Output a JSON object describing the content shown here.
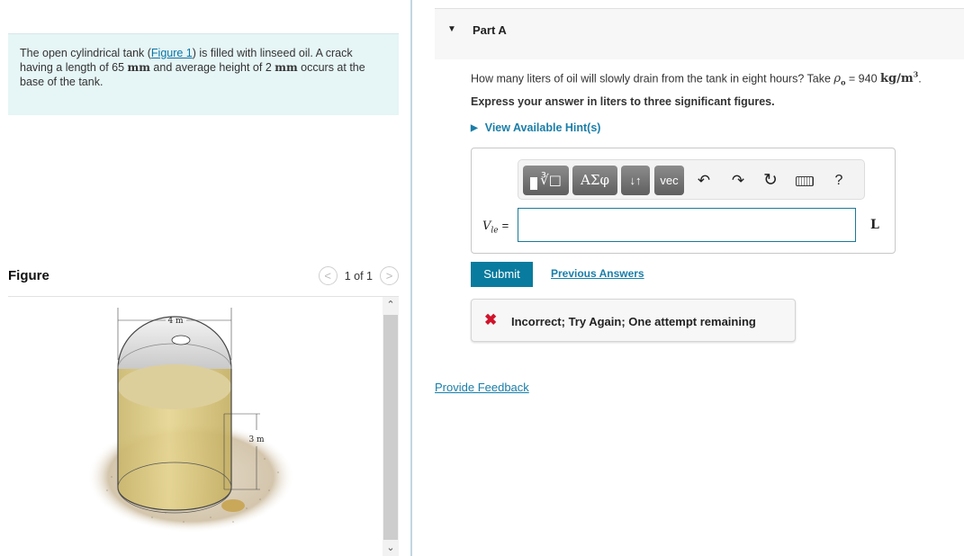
{
  "problem": {
    "text_before_link": "The open cylindrical tank (",
    "figure_link": "Figure 1",
    "text_after_link": ") is filled with linseed oil. A crack having a length of 65 ",
    "unit_mm_1": "mm",
    "text_mid": " and average height of 2 ",
    "unit_mm_2": "mm",
    "text_end": " occurs at the base of the tank."
  },
  "figure": {
    "title": "Figure",
    "counter": "1 of 1",
    "prev_icon": "chevron-left-icon",
    "next_icon": "chevron-right-icon",
    "diameter_label": "4 m",
    "height_label": "3 m",
    "colors": {
      "oil": "#d9c37a",
      "ground": "#d9cdb8",
      "tank_rim": "#cfcfcf"
    }
  },
  "part": {
    "caret": "▼",
    "title": "Part A",
    "question_prefix": "How many liters of oil will slowly drain from the tank in eight hours? Take ",
    "rho_symbol": "ρ",
    "rho_sub": "o",
    "question_equals": " = 940 ",
    "density_unit": "kg/m",
    "density_exp": "3",
    "question_suffix": ".",
    "instruction": "Express your answer in liters to three significant figures.",
    "hints_label": "View Available Hint(s)"
  },
  "toolbar": {
    "templates_label": "√",
    "greek_label": "ΑΣφ",
    "arrows_label": "↓↑",
    "vec_label": "vec",
    "undo_icon": "↶",
    "redo_icon": "↷",
    "reset_icon": "↻",
    "help_label": "?"
  },
  "answer": {
    "var_symbol": "V",
    "var_sub": "le",
    "equals": "=",
    "value": "",
    "unit": "L"
  },
  "actions": {
    "submit_label": "Submit",
    "previous_answers_label": "Previous Answers",
    "feedback_icon": "✖",
    "feedback_text": "Incorrect; Try Again; One attempt remaining",
    "provide_feedback_label": "Provide Feedback"
  },
  "colors": {
    "accent": "#097b9e",
    "link": "#1a7ea8",
    "problem_bg": "#e6f5f6",
    "error": "#d0142b"
  }
}
